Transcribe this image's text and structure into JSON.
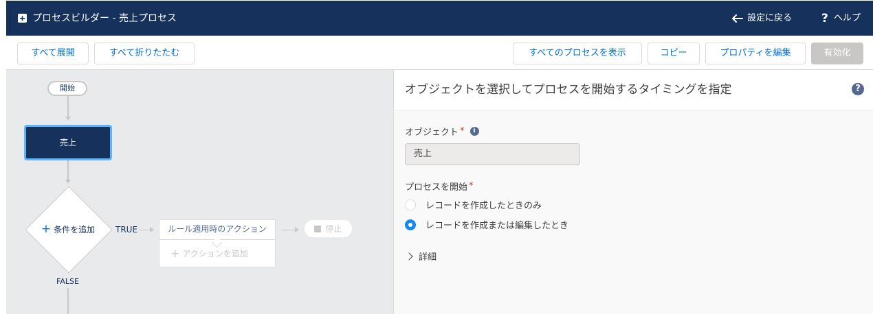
{
  "header": {
    "title": "プロセスビルダー - 売上プロセス",
    "back_label": "設定に戻る",
    "help_label": "ヘルプ",
    "help_glyph": "?",
    "logo_icon": "process-builder-icon",
    "bg_color": "#16325c"
  },
  "toolbar": {
    "expand_all": "すべて展開",
    "collapse_all": "すべて折りたたむ",
    "show_all_processes": "すべてのプロセスを表示",
    "copy": "コピー",
    "edit_properties": "プロパティを編集",
    "activate": "有効化"
  },
  "canvas": {
    "start_label": "開始",
    "object_node_label": "売上",
    "criteria_add_label": "条件を追加",
    "true_label": "TRUE",
    "false_label": "FALSE",
    "action_header": "ルール適用時のアクション",
    "action_add_label": "アクションを追加",
    "stop_label": "停止"
  },
  "panel": {
    "title": "オブジェクトを選択してプロセスを開始するタイミングを指定",
    "help_glyph": "?",
    "object_label": "オブジェクト",
    "required_mark": "*",
    "object_value": "売上",
    "start_label": "プロセスを開始",
    "radio_options": [
      {
        "label": "レコードを作成したときのみ",
        "selected": false
      },
      {
        "label": "レコードを作成または編集したとき",
        "selected": true
      }
    ],
    "details_label": "詳細"
  }
}
